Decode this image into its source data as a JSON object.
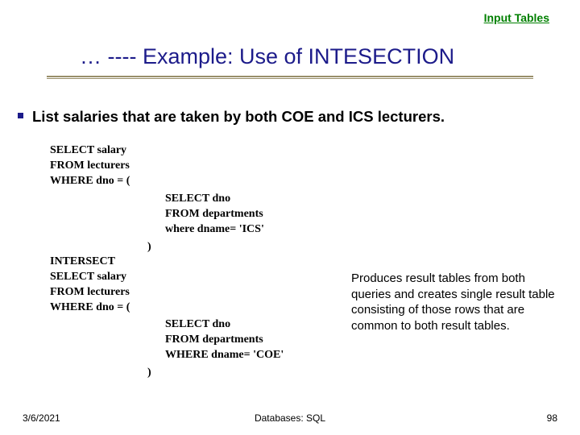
{
  "link": {
    "label": "Input Tables"
  },
  "title": "… ---- Example: Use of INTESECTION",
  "body": "List salaries that are taken by both COE and ICS lecturers.",
  "sql": {
    "block1": "SELECT salary\nFROM lecturers\nWHERE dno = (",
    "block2": "SELECT dno\nFROM departments\nwhere dname= 'ICS'",
    "block3": ")",
    "block4": "INTERSECT\nSELECT salary\nFROM lecturers\nWHERE dno = (",
    "block5": "SELECT dno\nFROM departments\nWHERE dname= 'COE'",
    "block6": ")"
  },
  "explanation": "Produces result tables from both queries and  creates single result table consisting of those rows that are common to both result tables.",
  "footer": {
    "date": "3/6/2021",
    "center": "Databases: SQL",
    "page": "98"
  }
}
